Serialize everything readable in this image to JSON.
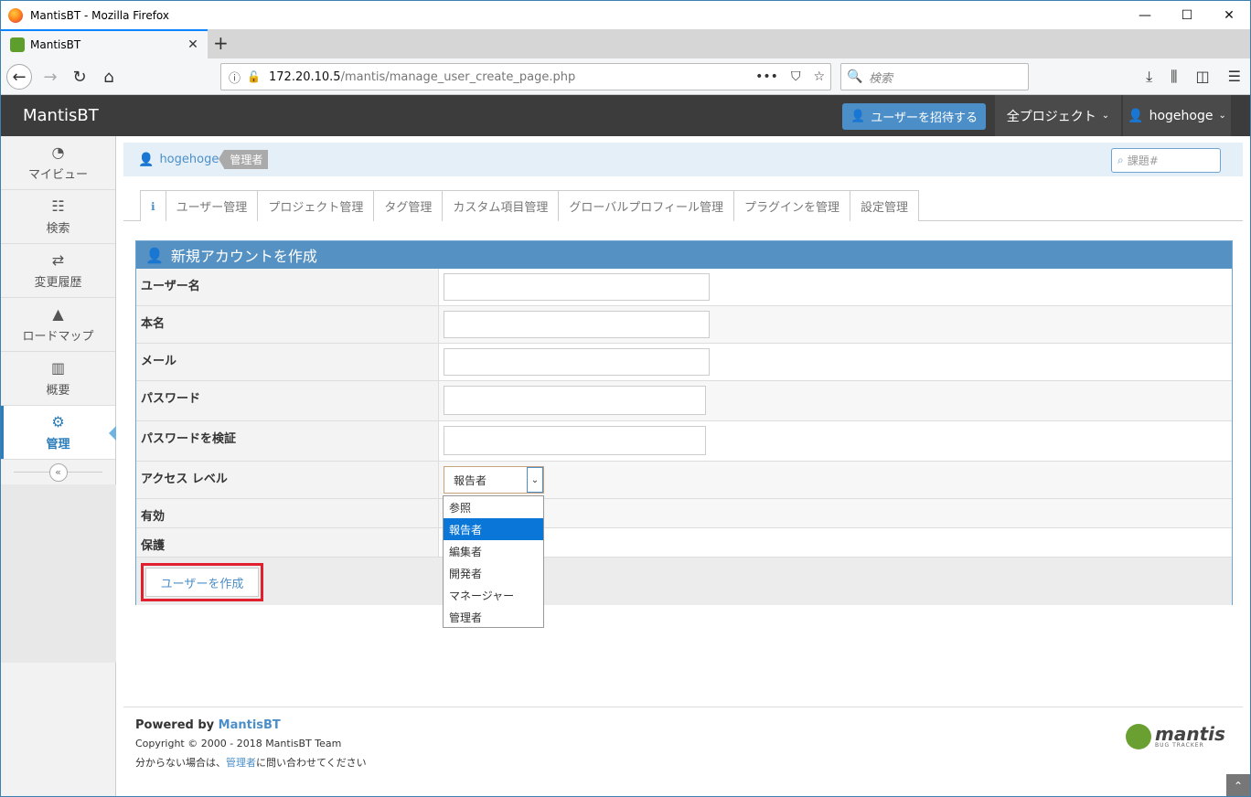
{
  "window": {
    "title": "MantisBT - Mozilla Firefox"
  },
  "browser": {
    "tab_title": "MantisBT",
    "url_host": "172.20.10.5",
    "url_path": "/mantis/manage_user_create_page.php",
    "search_placeholder": "検索"
  },
  "header": {
    "brand": "MantisBT",
    "invite_label": "ユーザーを招待する",
    "projects_label": "全プロジェクト",
    "user_label": "hogehoge"
  },
  "sidebar": {
    "items": [
      {
        "label": "マイビュー",
        "icon": "dashboard-icon"
      },
      {
        "label": "検索",
        "icon": "list-icon"
      },
      {
        "label": "変更履歴",
        "icon": "retweet-icon"
      },
      {
        "label": "ロードマップ",
        "icon": "road-icon"
      },
      {
        "label": "概要",
        "icon": "bar-chart-icon"
      },
      {
        "label": "管理",
        "icon": "gears-icon"
      }
    ],
    "collapse_glyph": "«"
  },
  "breadcrumb": {
    "username": "hogehoge",
    "role": "管理者",
    "search_placeholder": "課題#"
  },
  "manage_tabs": [
    "ユーザー管理",
    "プロジェクト管理",
    "タグ管理",
    "カスタム項目管理",
    "グローバルプロフィール管理",
    "プラグインを管理",
    "設定管理"
  ],
  "form": {
    "title": "新規アカウントを作成",
    "fields": {
      "username": "ユーザー名",
      "realname": "本名",
      "email": "メール",
      "password": "パスワード",
      "password_verify": "パスワードを検証",
      "access_level": "アクセス レベル",
      "enabled": "有効",
      "protected": "保護"
    },
    "access_level_value": "報告者",
    "access_level_options": [
      "参照",
      "報告者",
      "編集者",
      "開発者",
      "マネージャー",
      "管理者"
    ],
    "submit_label": "ユーザーを作成"
  },
  "footer": {
    "powered_prefix": "Powered by ",
    "powered_link": "MantisBT",
    "copyright": "Copyright © 2000 - 2018 MantisBT Team",
    "help_prefix": "分からない場合は、",
    "help_link": "管理者",
    "help_suffix": "に問い合わせてください",
    "logo_text": "mantis",
    "logo_sub": "BUG TRACKER"
  },
  "colors": {
    "accent": "#4c8fc8",
    "header": "#3c3c3c",
    "highlight": "#e0202e"
  }
}
